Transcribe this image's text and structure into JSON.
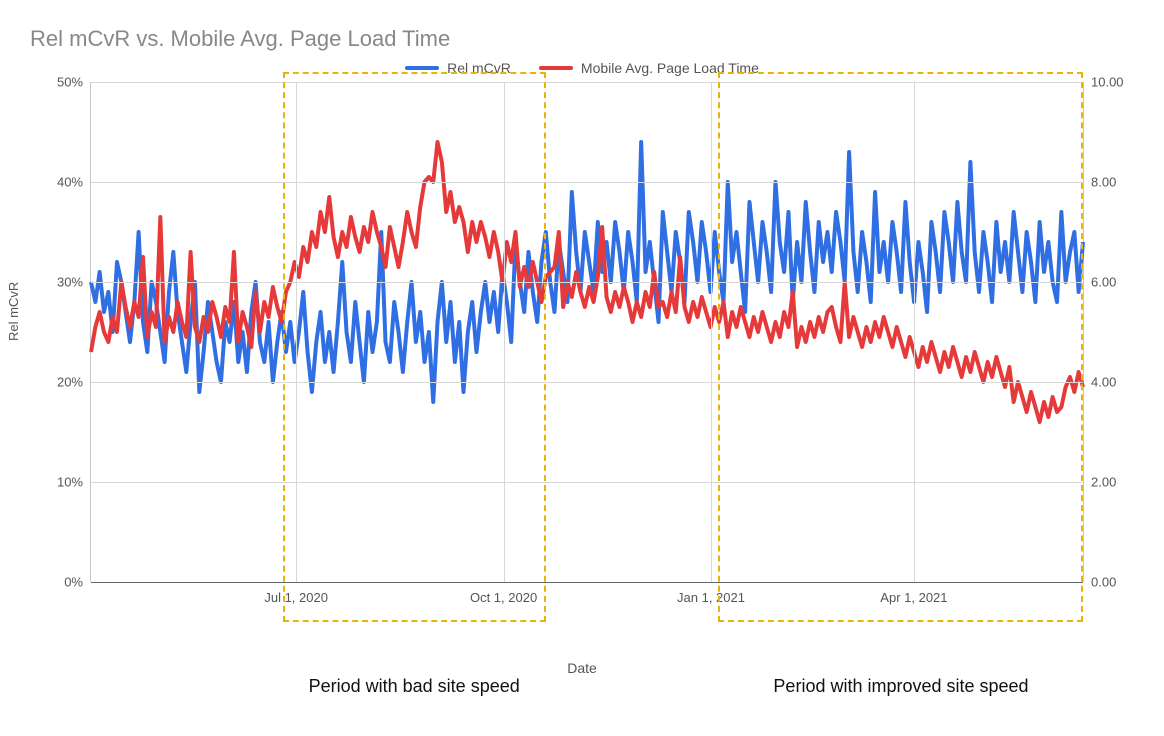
{
  "title": "Rel mCvR vs. Mobile Avg. Page Load Time",
  "legend": {
    "rel": "Rel mCvR",
    "load": "Mobile Avg. Page Load Time"
  },
  "axis": {
    "y_left_label": "Rel mCvR",
    "x_label": "Date",
    "y_left_ticks": [
      "0%",
      "10%",
      "20%",
      "30%",
      "40%",
      "50%"
    ],
    "y_right_ticks": [
      "0.00",
      "2.00",
      "4.00",
      "6.00",
      "8.00",
      "10.00"
    ],
    "x_ticks": [
      "Jul 1, 2020",
      "Oct 1, 2020",
      "Jan 1, 2021",
      "Apr 1, 2021"
    ]
  },
  "annotations": {
    "bad": "Period with bad site speed",
    "good": "Period with improved site speed"
  },
  "colors": {
    "rel": "#2f6fe3",
    "load": "#e63939",
    "highlight": "#eab308"
  },
  "chart_data": {
    "type": "line",
    "title": "Rel mCvR vs. Mobile Avg. Page Load Time",
    "xlabel": "Date",
    "ylabel_left": "Rel mCvR",
    "ylabel_right": "Mobile Avg. Page Load Time",
    "ylim_left": [
      0,
      50
    ],
    "ylim_right": [
      0,
      10
    ],
    "x_range": [
      "2020-04-01",
      "2021-06-15"
    ],
    "x_ticks": [
      "2020-07-01",
      "2020-10-01",
      "2021-01-01",
      "2021-04-01"
    ],
    "highlights": [
      {
        "label": "Period with bad site speed",
        "start": "2020-06-25",
        "end": "2020-10-20"
      },
      {
        "label": "Period with improved site speed",
        "start": "2021-01-04",
        "end": "2021-06-15"
      }
    ],
    "series": [
      {
        "name": "Rel mCvR",
        "axis": "left",
        "color": "#2f6fe3",
        "unit": "%",
        "values": [
          30,
          28,
          31,
          27,
          29,
          25,
          32,
          30,
          27,
          24,
          28,
          35,
          26,
          23,
          30,
          28,
          25,
          22,
          29,
          33,
          27,
          24,
          21,
          26,
          30,
          19,
          23,
          28,
          25,
          22,
          20,
          26,
          24,
          28,
          22,
          25,
          21,
          27,
          30,
          24,
          22,
          26,
          20,
          24,
          27,
          23,
          26,
          22,
          25,
          29,
          23,
          19,
          24,
          27,
          22,
          25,
          21,
          26,
          32,
          25,
          22,
          28,
          24,
          20,
          27,
          23,
          26,
          35,
          24,
          22,
          28,
          25,
          21,
          26,
          30,
          24,
          27,
          22,
          25,
          18,
          26,
          30,
          24,
          28,
          22,
          26,
          19,
          25,
          28,
          23,
          27,
          30,
          26,
          29,
          25,
          31,
          28,
          24,
          34,
          30,
          27,
          33,
          29,
          26,
          32,
          35,
          30,
          27,
          34,
          31,
          28,
          39,
          33,
          29,
          35,
          32,
          29,
          36,
          31,
          34,
          30,
          36,
          33,
          29,
          35,
          32,
          28,
          44,
          31,
          34,
          30,
          26,
          37,
          33,
          29,
          35,
          32,
          28,
          37,
          34,
          30,
          36,
          33,
          29,
          35,
          31,
          28,
          40,
          32,
          35,
          31,
          27,
          38,
          34,
          30,
          36,
          33,
          29,
          40,
          34,
          31,
          37,
          28,
          34,
          30,
          38,
          33,
          29,
          36,
          32,
          35,
          31,
          37,
          34,
          30,
          43,
          33,
          29,
          35,
          32,
          28,
          39,
          31,
          34,
          30,
          36,
          33,
          29,
          38,
          32,
          28,
          34,
          31,
          27,
          36,
          33,
          29,
          37,
          34,
          30,
          38,
          33,
          30,
          42,
          33,
          29,
          35,
          32,
          28,
          36,
          31,
          34,
          30,
          37,
          33,
          29,
          35,
          32,
          28,
          36,
          31,
          34,
          30,
          28,
          37,
          30,
          33,
          35,
          29,
          34
        ]
      },
      {
        "name": "Mobile Avg. Page Load Time",
        "axis": "right",
        "color": "#e63939",
        "unit": "",
        "values": [
          4.6,
          5.1,
          5.4,
          5.0,
          4.8,
          5.3,
          5.0,
          6.0,
          5.5,
          5.1,
          5.6,
          5.3,
          6.5,
          4.9,
          5.4,
          5.1,
          7.3,
          4.8,
          5.3,
          5.0,
          5.6,
          5.2,
          4.9,
          6.6,
          5.1,
          4.8,
          5.3,
          5.0,
          5.6,
          5.3,
          4.9,
          5.5,
          5.2,
          6.6,
          4.8,
          5.4,
          5.1,
          4.7,
          5.8,
          5.0,
          5.6,
          5.3,
          5.9,
          5.5,
          5.2,
          5.8,
          6.0,
          6.4,
          6.1,
          6.7,
          6.4,
          7.0,
          6.7,
          7.4,
          7.0,
          7.7,
          6.9,
          6.5,
          7.0,
          6.7,
          7.3,
          6.9,
          6.6,
          7.1,
          6.8,
          7.4,
          7.0,
          6.7,
          6.3,
          7.1,
          6.7,
          6.3,
          6.8,
          7.4,
          7.0,
          6.7,
          7.5,
          8.0,
          8.1,
          8.0,
          8.8,
          8.4,
          7.4,
          7.8,
          7.2,
          7.5,
          7.2,
          6.6,
          7.2,
          6.8,
          7.2,
          6.9,
          6.5,
          7.0,
          6.6,
          6.0,
          6.8,
          6.4,
          7.0,
          5.9,
          6.3,
          5.9,
          6.4,
          6.0,
          5.6,
          6.1,
          6.2,
          6.3,
          7.0,
          5.5,
          6.0,
          5.7,
          6.2,
          5.8,
          5.5,
          5.9,
          5.6,
          6.1,
          7.1,
          5.7,
          5.4,
          5.8,
          5.5,
          5.9,
          5.6,
          5.2,
          5.6,
          5.3,
          5.8,
          5.5,
          6.2,
          5.5,
          5.6,
          5.3,
          5.8,
          5.4,
          6.5,
          5.5,
          5.2,
          5.6,
          5.3,
          5.7,
          5.4,
          5.1,
          5.5,
          5.2,
          5.6,
          4.9,
          5.4,
          5.1,
          5.5,
          5.2,
          4.9,
          5.3,
          5.0,
          5.4,
          5.1,
          4.8,
          5.2,
          4.9,
          5.4,
          5.1,
          5.8,
          4.7,
          5.1,
          4.8,
          5.2,
          4.9,
          5.3,
          5.0,
          5.4,
          5.5,
          5.1,
          4.8,
          6.0,
          4.9,
          5.3,
          5.0,
          4.7,
          5.1,
          4.8,
          5.2,
          4.9,
          5.3,
          5.0,
          4.7,
          5.1,
          4.8,
          4.5,
          4.9,
          4.6,
          4.3,
          4.7,
          4.4,
          4.8,
          4.5,
          4.2,
          4.6,
          4.3,
          4.7,
          4.4,
          4.1,
          4.5,
          4.2,
          4.6,
          4.3,
          4.0,
          4.4,
          4.1,
          4.5,
          4.2,
          3.9,
          4.3,
          3.6,
          4.0,
          3.7,
          3.4,
          3.8,
          3.5,
          3.2,
          3.6,
          3.3,
          3.7,
          3.4,
          3.5,
          3.9,
          4.1,
          3.8,
          4.2,
          3.9
        ]
      }
    ]
  }
}
